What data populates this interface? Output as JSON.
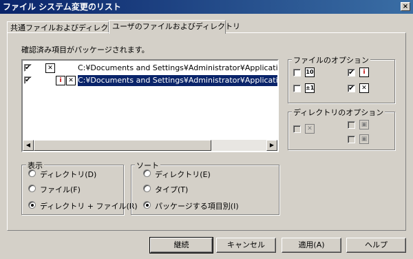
{
  "window": {
    "title": "ファイル システム変更のリスト",
    "close_symbol": "×"
  },
  "tabs": [
    {
      "label": "共通ファイルおよびディレクトリ"
    },
    {
      "label": "ユーザのファイルおよびディレクトリ",
      "active": true
    }
  ],
  "instruction": "確認済み項目がパッケージされます。",
  "list": {
    "rows": [
      {
        "checked": true,
        "text": "C:¥Documents and Settings¥Administrator¥Application D",
        "selected": false
      },
      {
        "checked": true,
        "text": "C:¥Documents and Settings¥Administrator¥Application D",
        "selected": true
      }
    ]
  },
  "glyphs": {
    "check": "✔",
    "left": "◀",
    "right": "▶",
    "info": "i",
    "x": "✕",
    "ten": "10",
    "plus_minus": "±1",
    "pen": "✎"
  },
  "file_options": {
    "title": "ファイルのオプション",
    "items": [
      {
        "checked": false,
        "icon": "10"
      },
      {
        "checked": true,
        "icon": "i"
      },
      {
        "checked": false,
        "icon": "±1"
      },
      {
        "checked": true,
        "icon": "✕"
      }
    ]
  },
  "dir_options": {
    "title": "ディレクトリのオプション",
    "items": [
      {
        "checked": false,
        "icon": "✕"
      },
      {
        "checked": false,
        "icon": "▣"
      },
      {
        "checked": false,
        "icon": "▣"
      }
    ]
  },
  "display": {
    "title": "表示",
    "options": [
      {
        "label": "ディレクトリ(D)",
        "selected": false
      },
      {
        "label": "ファイル(F)",
        "selected": false
      },
      {
        "label": "ディレクトリ + ファイル(R)",
        "selected": true
      }
    ]
  },
  "sort": {
    "title": "ソート",
    "options": [
      {
        "label": "ディレクトリ(E)",
        "selected": false
      },
      {
        "label": "タイプ(T)",
        "selected": false
      },
      {
        "label": "パッケージする項目別(I)",
        "selected": true
      }
    ]
  },
  "buttons": {
    "continue": "継続",
    "cancel": "キャンセル",
    "apply": "適用(A)",
    "help": "ヘルプ"
  }
}
